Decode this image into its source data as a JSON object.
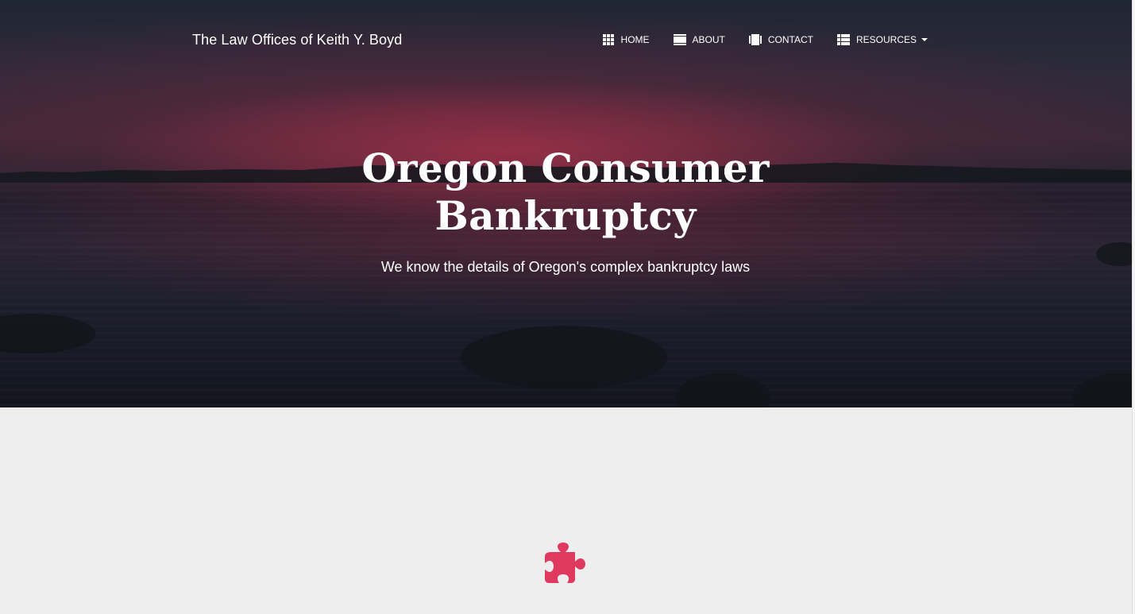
{
  "brand": "The Law Offices of Keith Y. Boyd",
  "nav": {
    "items": [
      {
        "label": "HOME",
        "icon": "grid-icon"
      },
      {
        "label": "ABOUT",
        "icon": "panel-icon"
      },
      {
        "label": "CONTACT",
        "icon": "carousel-icon"
      },
      {
        "label": "RESOURCES",
        "icon": "list-icon",
        "dropdown": true
      }
    ]
  },
  "hero": {
    "title_line1": "Oregon Consumer",
    "title_line2": "Bankruptcy",
    "subtitle": "We know the details of Oregon's complex bankruptcy laws"
  },
  "content": {
    "feature_icon": "puzzle-icon"
  },
  "colors": {
    "accent": "#e0395f",
    "background": "#eeeeee",
    "nav_text": "#ffffff"
  }
}
